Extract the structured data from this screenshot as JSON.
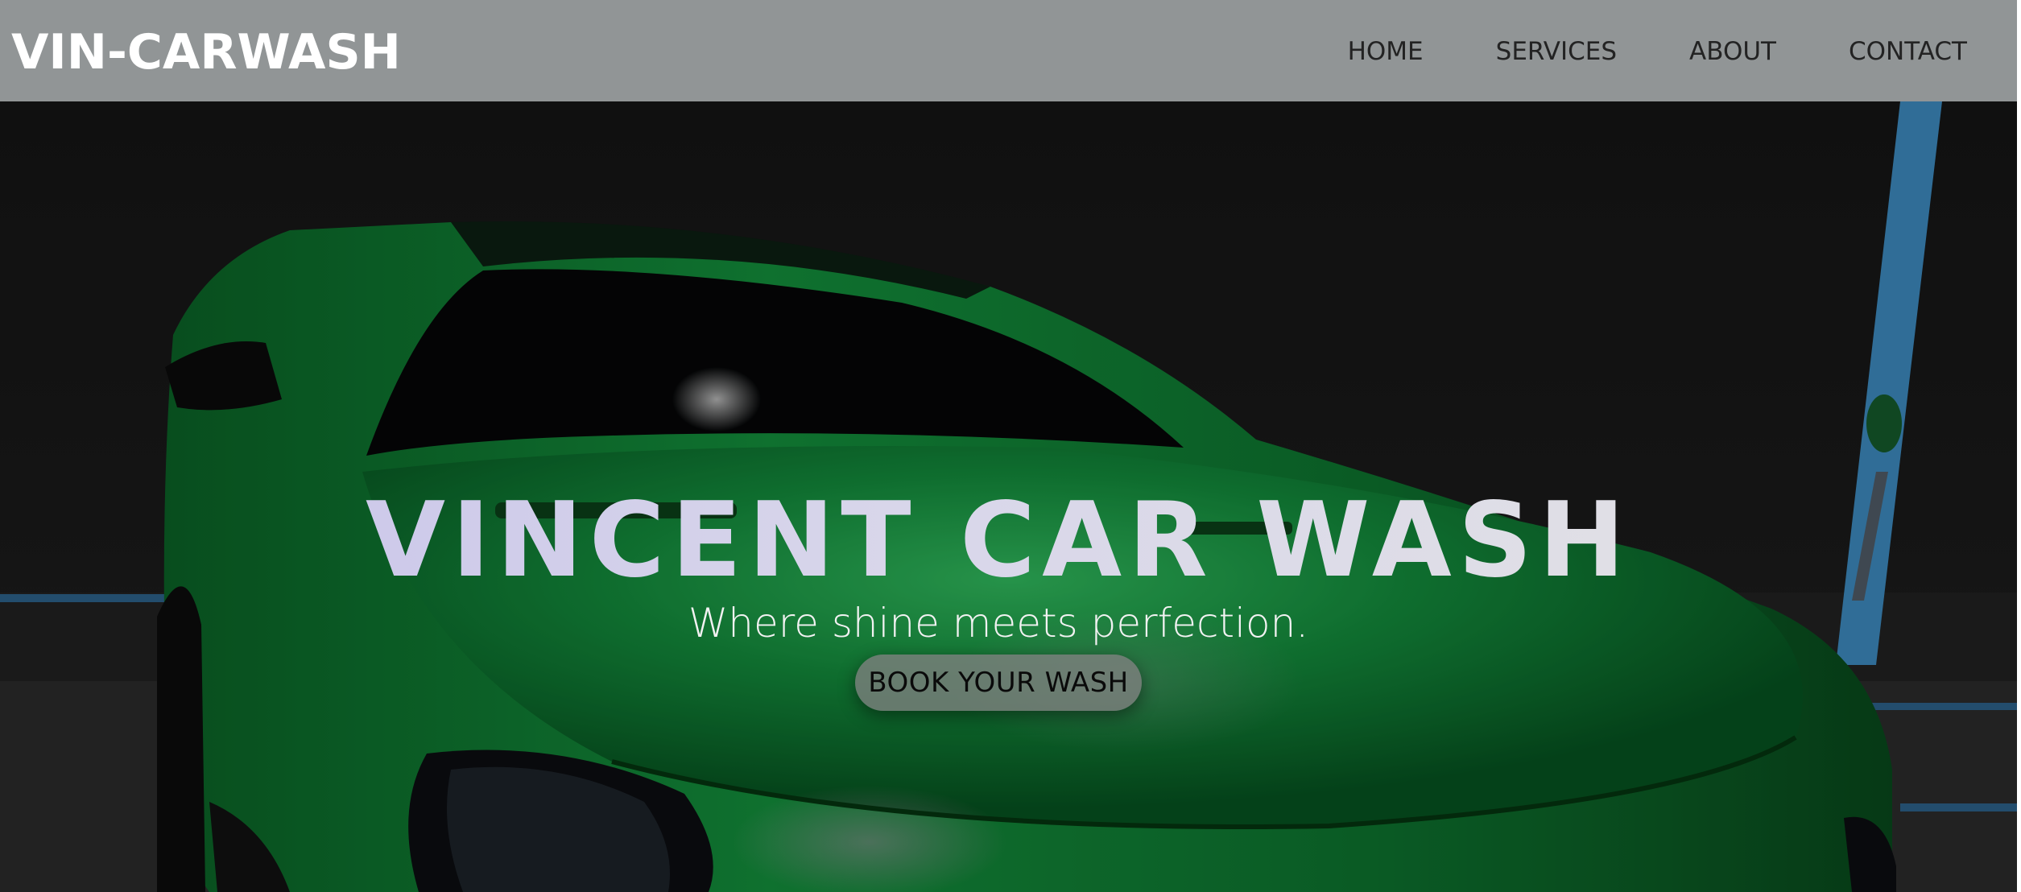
{
  "header": {
    "logo": "VIN-CARWASH",
    "nav": [
      {
        "label": "HOME"
      },
      {
        "label": "SERVICES"
      },
      {
        "label": "ABOUT"
      },
      {
        "label": "CONTACT"
      }
    ]
  },
  "hero": {
    "title": "VINCENT CAR WASH",
    "tagline": "Where shine meets perfection.",
    "cta_label": "BOOK YOUR WASH",
    "background_image": "green sports car in dark garage"
  },
  "colors": {
    "header_bg": "#919596",
    "car_green": "#0e7a2e",
    "title_tint": "#cfcbea",
    "cta_bg": "#7f7f7f"
  },
  "icons": {
    "hero_photo": "car-photo"
  }
}
